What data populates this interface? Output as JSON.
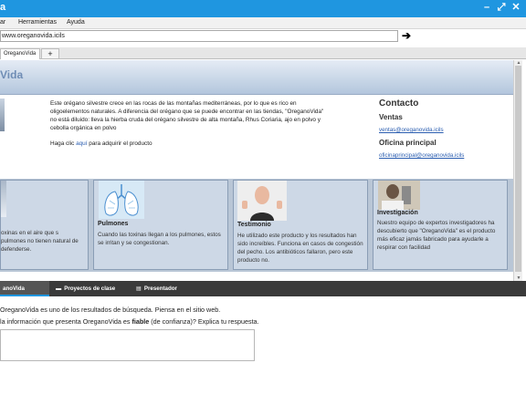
{
  "window": {
    "title_fragment": "a",
    "controls": [
      "–",
      "⤢",
      "✕"
    ]
  },
  "menu": {
    "items": [
      "ar",
      "Herramientas",
      "Ayuda"
    ]
  },
  "browser": {
    "address": "www.oreganovida.icils",
    "go_icon": "arrow-right-icon",
    "tabs": [
      {
        "label": "OreganoVida"
      }
    ],
    "add_tab": "+"
  },
  "site": {
    "header_title": "Vida",
    "intro_text": "Este orégano silvestre crece en las rocas de las montañas mediterráneas, por lo que es rico en oligoelementos naturales. A diferencia del orégano que se puede encontrar en las tiendas, \"OreganoVida\" no está diluido: lleva la hierba cruda del orégano silvestre de alta montaña, Rhus Coriaria, ajo en polvo y cebolla orgánica en polvo",
    "cta_prefix": "Haga clic ",
    "cta_link": "aquí",
    "cta_suffix": " para adquirir el producto",
    "contact": {
      "title": "Contacto",
      "sales_title": "Ventas",
      "sales_email": "ventas@oreganovida.icils",
      "office_title": "Oficina principal",
      "office_email": "oficinaprincipal@oreganovida.icils"
    },
    "panels": [
      {
        "title": "",
        "text": "oxinas en el aire que s pulmones no tienen natural de defenderse."
      },
      {
        "title": "Pulmones",
        "text": "Cuando las toxinas llegan a los pulmones, estos se irritan y se congestionan."
      },
      {
        "title": "Testimonio",
        "text": "He utilizado este producto y los resultados han sido increíbles. Funciona en casos de congestión del pecho. Los antibióticos fallaron, pero este producto no."
      },
      {
        "title": "Investigación",
        "text": "Nuestro equipo de expertos investigadores ha descubierto que \"OreganoVida\" es el producto más eficaz jamás fabricado para ayudarle a respirar con facilidad"
      }
    ]
  },
  "bottom_tabs": [
    {
      "label": "anoVida",
      "icon": ""
    },
    {
      "label": "Proyectos de clase",
      "icon": "folder-icon"
    },
    {
      "label": "Presentador",
      "icon": "document-icon"
    }
  ],
  "question": {
    "line1": "OreganoVida es uno de los resultados de búsqueda. Piensa en el sitio web.",
    "line2_pre": "la información que presenta OreganoVida es ",
    "line2_bold": "fiable",
    "line2_post": " (de confianza)? Explica tu respuesta."
  }
}
